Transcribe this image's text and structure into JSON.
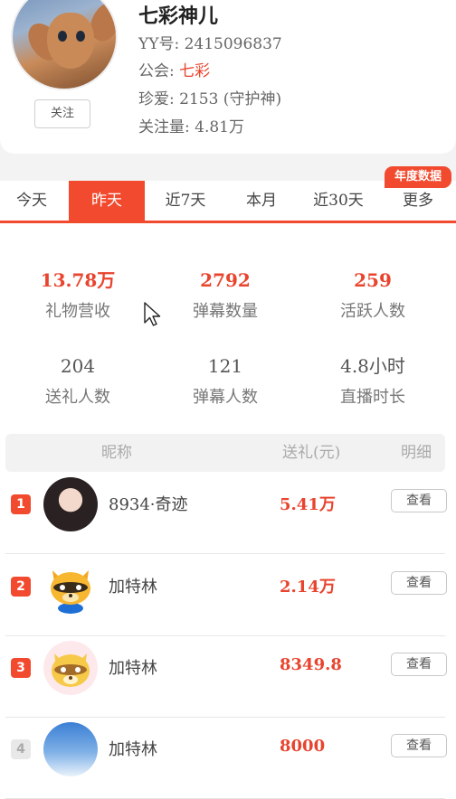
{
  "profile": {
    "nickname": "七彩神儿",
    "yy_label": "YY号:",
    "yy_value": "2415096837",
    "guild_label": "公会:",
    "guild_value": "七彩",
    "treasure_label": "珍爱:",
    "treasure_value": "2153 (守护神)",
    "followers_label": "关注量:",
    "followers_value": "4.81万",
    "follow_button": "关注"
  },
  "annual_badge": "年度数据",
  "tabs": [
    {
      "label": "今天"
    },
    {
      "label": "昨天",
      "active": true
    },
    {
      "label": "近7天"
    },
    {
      "label": "本月"
    },
    {
      "label": "近30天"
    },
    {
      "label": "更多"
    }
  ],
  "stats": [
    {
      "value": "13.78万",
      "label": "礼物营收",
      "highlight": true
    },
    {
      "value": "2792",
      "label": "弹幕数量",
      "highlight": true
    },
    {
      "value": "259",
      "label": "活跃人数",
      "highlight": true
    },
    {
      "value": "204",
      "label": "送礼人数",
      "highlight": false
    },
    {
      "value": "121",
      "label": "弹幕人数",
      "highlight": false
    },
    {
      "value": "4.8小时",
      "label": "直播时长",
      "highlight": false
    }
  ],
  "ranking": {
    "headers": {
      "name": "昵称",
      "gift": "送礼(元)",
      "detail": "明细"
    },
    "rows": [
      {
        "rank": "1",
        "name": "8934·奇迹",
        "amount": "5.41万",
        "action": "查看",
        "avatar": "woman-photo-icon"
      },
      {
        "rank": "2",
        "name": "加特林",
        "amount": "2.14万",
        "action": "查看",
        "avatar": "raccoon-mascot-icon"
      },
      {
        "rank": "3",
        "name": "加特林",
        "amount": "8349.8",
        "action": "查看",
        "avatar": "raccoon-mascot-pale-icon"
      },
      {
        "rank": "4",
        "name": "加特林",
        "amount": "8000",
        "action": "查看",
        "avatar": "sky-photo-icon"
      }
    ]
  },
  "colors": {
    "accent": "#f24a2e",
    "amount": "#e8442e"
  }
}
